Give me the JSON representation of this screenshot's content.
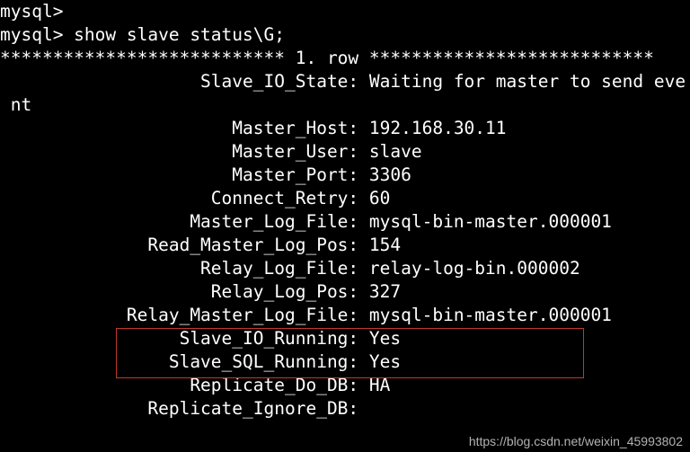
{
  "prompt1": "mysql>",
  "prompt2": "mysql> ",
  "command": "show slave status\\G;",
  "row_header_left": "*************************** ",
  "row_header_mid": "1. row",
  "row_header_right": " ***************************",
  "fields": [
    {
      "label": "Slave_IO_State",
      "value": "Waiting for master to send event"
    },
    {
      "label": "Master_Host",
      "value": "192.168.30.11"
    },
    {
      "label": "Master_User",
      "value": "slave"
    },
    {
      "label": "Master_Port",
      "value": "3306"
    },
    {
      "label": "Connect_Retry",
      "value": "60"
    },
    {
      "label": "Master_Log_File",
      "value": "mysql-bin-master.000001"
    },
    {
      "label": "Read_Master_Log_Pos",
      "value": "154"
    },
    {
      "label": "Relay_Log_File",
      "value": "relay-log-bin.000002"
    },
    {
      "label": "Relay_Log_Pos",
      "value": "327"
    },
    {
      "label": "Relay_Master_Log_File",
      "value": "mysql-bin-master.000001"
    },
    {
      "label": "Slave_IO_Running",
      "value": "Yes"
    },
    {
      "label": "Slave_SQL_Running",
      "value": "Yes"
    },
    {
      "label": "Replicate_Do_DB",
      "value": "HA"
    },
    {
      "label": "Replicate_Ignore_DB",
      "value": ""
    }
  ],
  "label_col_width": 33,
  "chart_data": {
    "type": "table",
    "title": "MySQL SHOW SLAVE STATUS output",
    "command": "show slave status\\G;",
    "highlighted_rows": [
      "Slave_IO_Running",
      "Slave_SQL_Running"
    ],
    "rows": [
      {
        "field": "Slave_IO_State",
        "value": "Waiting for master to send event"
      },
      {
        "field": "Master_Host",
        "value": "192.168.30.11"
      },
      {
        "field": "Master_User",
        "value": "slave"
      },
      {
        "field": "Master_Port",
        "value": 3306
      },
      {
        "field": "Connect_Retry",
        "value": 60
      },
      {
        "field": "Master_Log_File",
        "value": "mysql-bin-master.000001"
      },
      {
        "field": "Read_Master_Log_Pos",
        "value": 154
      },
      {
        "field": "Relay_Log_File",
        "value": "relay-log-bin.000002"
      },
      {
        "field": "Relay_Log_Pos",
        "value": 327
      },
      {
        "field": "Relay_Master_Log_File",
        "value": "mysql-bin-master.000001"
      },
      {
        "field": "Slave_IO_Running",
        "value": "Yes"
      },
      {
        "field": "Slave_SQL_Running",
        "value": "Yes"
      },
      {
        "field": "Replicate_Do_DB",
        "value": "HA"
      },
      {
        "field": "Replicate_Ignore_DB",
        "value": ""
      }
    ]
  },
  "watermark": "https://blog.csdn.net/weixin_45993802"
}
